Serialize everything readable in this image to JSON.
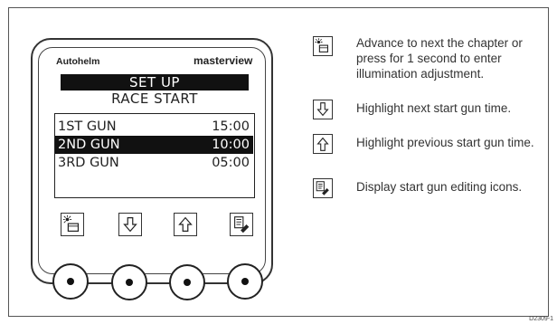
{
  "device": {
    "brand": "Autohelm",
    "model": "masterview",
    "screen": {
      "title": "SET UP",
      "subtitle": "RACE START",
      "guns": [
        {
          "name": "1ST GUN",
          "time": "15:00",
          "selected": false
        },
        {
          "name": "2ND GUN",
          "time": "10:00",
          "selected": true
        },
        {
          "name": "3RD GUN",
          "time": "05:00",
          "selected": false
        }
      ]
    },
    "keys": [
      "illumination-chapter-icon",
      "arrow-down-icon",
      "arrow-up-icon",
      "edit-pen-icon"
    ],
    "knobs": 4
  },
  "legend": [
    {
      "icon": "illumination-chapter-icon",
      "text": "Advance to next the chapter or press for 1 second to enter illumination adjustment."
    },
    {
      "icon": "arrow-down-icon",
      "text": "Highlight next start gun time."
    },
    {
      "icon": "arrow-up-icon",
      "text": "Highlight previous start gun time."
    },
    {
      "icon": "edit-pen-icon",
      "text": "Display start gun editing icons."
    }
  ],
  "figure_code": "D2309-1"
}
